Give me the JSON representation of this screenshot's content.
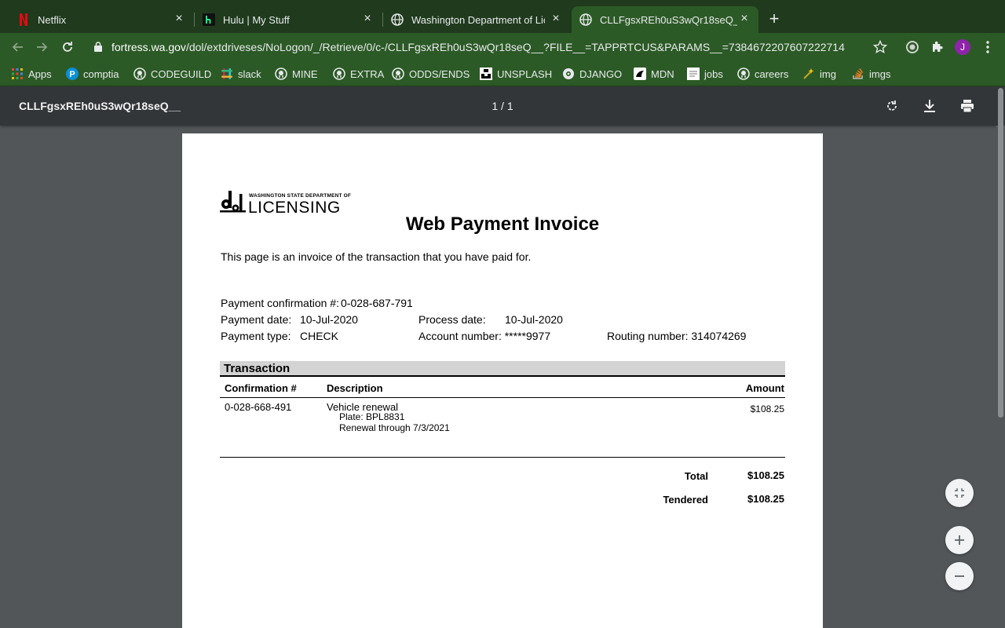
{
  "browser": {
    "tabs": [
      {
        "title": "Netflix",
        "icon": "netflix-icon",
        "active": false
      },
      {
        "title": "Hulu | My Stuff",
        "icon": "hulu-icon",
        "active": false
      },
      {
        "title": "Washington Department of Lic",
        "icon": "globe-icon",
        "active": false
      },
      {
        "title": "CLLFgsxREh0uS3wQr18seQ__",
        "icon": "globe-icon",
        "active": true
      }
    ],
    "url_host": "fortress.wa.gov",
    "url_path": "/dol/extdriveses/NoLogon/_/Retrieve/0/c-/CLLFgsxREh0uS3wQr18seQ__?FILE__=TAPPRTCUS&PARAMS__=7384672207607222714",
    "profile_initial": "J",
    "colors": {
      "frame": "#1f3a1c",
      "toolbar": "#2c5a26",
      "avatar": "#8e24aa"
    }
  },
  "bookmarks": [
    {
      "label": "Apps",
      "icon": "apps-grid-icon"
    },
    {
      "label": "comptia",
      "icon": "pearson-icon"
    },
    {
      "label": "CODEGUILD",
      "icon": "github-icon"
    },
    {
      "label": "slack",
      "icon": "slack-icon"
    },
    {
      "label": "MINE",
      "icon": "github-icon"
    },
    {
      "label": "EXTRA",
      "icon": "github-icon"
    },
    {
      "label": "ODDS/ENDS",
      "icon": "github-icon"
    },
    {
      "label": "UNSPLASH",
      "icon": "unsplash-icon"
    },
    {
      "label": "DJANGO",
      "icon": "django-icon"
    },
    {
      "label": "MDN",
      "icon": "mdn-icon"
    },
    {
      "label": "jobs",
      "icon": "page-icon"
    },
    {
      "label": "careers",
      "icon": "github-icon"
    },
    {
      "label": "img",
      "icon": "wand-icon"
    },
    {
      "label": "imgs",
      "icon": "stackoverflow-icon"
    }
  ],
  "pdf": {
    "title": "CLLFgsxREh0uS3wQr18seQ__",
    "page_indicator": "1 / 1"
  },
  "invoice": {
    "logo_small": "WASHINGTON STATE DEPARTMENT OF",
    "logo_big": "LICENSING",
    "logo_mark": "dol",
    "title": "Web Payment Invoice",
    "intro": "This page is an invoice of the transaction that you have paid for.",
    "payment_confirmation_label": "Payment confirmation #:",
    "payment_confirmation": "0-028-687-791",
    "payment_date_label": "Payment date:",
    "payment_date": "10-Jul-2020",
    "process_date_label": "Process date:",
    "process_date": "10-Jul-2020",
    "payment_type_label": "Payment type:",
    "payment_type": "CHECK",
    "account_number": "Account number: *****9977",
    "routing_number": "Routing number: 314074269",
    "section_title": "Transaction",
    "columns": {
      "confirmation": "Confirmation #",
      "description": "Description",
      "amount": "Amount"
    },
    "line_item": {
      "confirmation": "0-028-668-491",
      "description": "Vehicle renewal",
      "plate": "Plate: BPL8831",
      "renewal": "Renewal through 7/3/2021",
      "amount": "$108.25"
    },
    "total_label": "Total",
    "total": "$108.25",
    "tendered_label": "Tendered",
    "tendered": "$108.25"
  }
}
